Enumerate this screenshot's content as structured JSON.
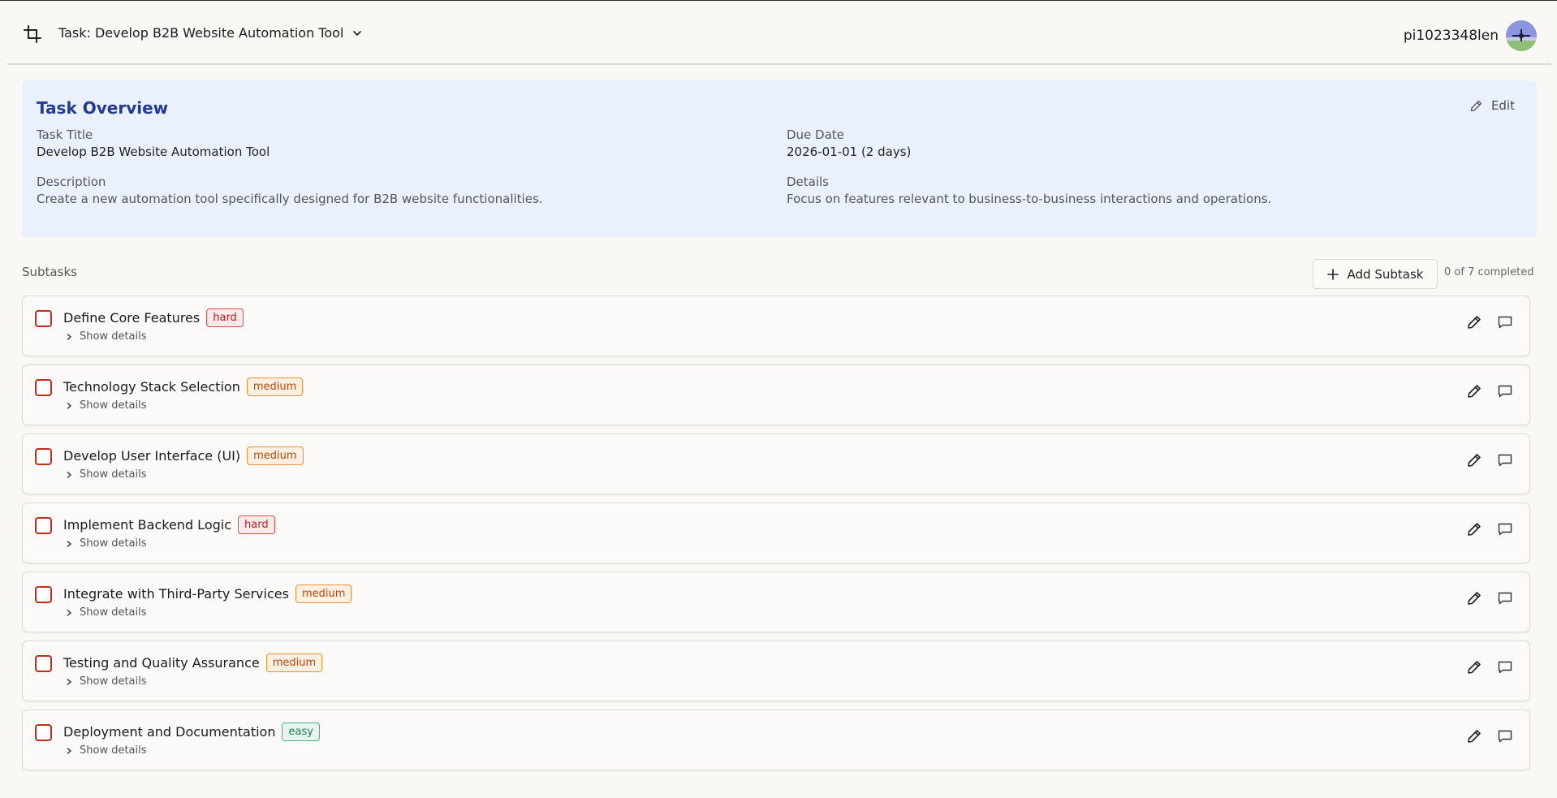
{
  "header": {
    "task_title": "Task: Develop B2B Website Automation Tool",
    "username": "pi1023348len"
  },
  "overview": {
    "heading": "Task Overview",
    "edit_label": "Edit",
    "task_title_label": "Task Title",
    "task_title_value": "Develop B2B Website Automation Tool",
    "due_date_label": "Due Date",
    "due_date_value": "2026-01-01 (2 days)",
    "description_label": "Description",
    "description_value": "Create a new automation tool specifically designed for B2B website functionalities.",
    "details_label": "Details",
    "details_value": "Focus on features relevant to business-to-business interactions and operations."
  },
  "subtasks_section": {
    "label": "Subtasks",
    "add_label": "Add Subtask",
    "completed_text": "0 of 7 completed"
  },
  "show_details_label": "Show details",
  "subtasks": [
    {
      "name": "Define Core Features",
      "difficulty": "hard"
    },
    {
      "name": "Technology Stack Selection",
      "difficulty": "medium"
    },
    {
      "name": "Develop User Interface (UI)",
      "difficulty": "medium"
    },
    {
      "name": "Implement Backend Logic",
      "difficulty": "hard"
    },
    {
      "name": "Integrate with Third-Party Services",
      "difficulty": "medium"
    },
    {
      "name": "Testing and Quality Assurance",
      "difficulty": "medium"
    },
    {
      "name": "Deployment and Documentation",
      "difficulty": "easy"
    }
  ],
  "colors": {
    "overview_bg": "#eaf1fd",
    "overview_title": "#213a98",
    "checkbox_border": "#c22d1d",
    "hard": "#b32020",
    "medium": "#b5470f",
    "easy": "#1d7a52"
  },
  "icons": {
    "brand": "crop-icon",
    "switch": "chevron-down-icon",
    "edit": "pencil-icon",
    "add": "plus-icon",
    "toggle": "chevron-right-icon",
    "comment": "comment-icon"
  }
}
